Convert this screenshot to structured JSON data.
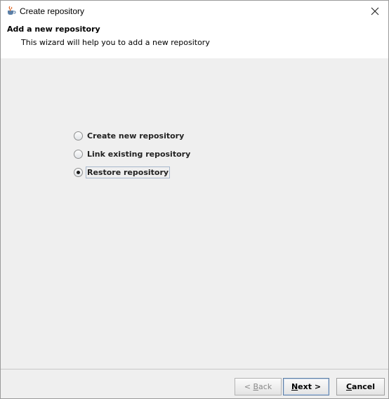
{
  "window": {
    "title": "Create repository",
    "app_icon": "coffee-cup-icon",
    "close_icon": "close-icon"
  },
  "header": {
    "title": "Add a new repository",
    "subtitle": "This wizard will help you to add a new repository"
  },
  "options": [
    {
      "label": "Create new repository",
      "checked": false
    },
    {
      "label": "Link existing repository",
      "checked": false
    },
    {
      "label": "Restore repository",
      "checked": true
    }
  ],
  "footer": {
    "back": {
      "prefix": "< ",
      "mnemonic": "B",
      "rest": "ack",
      "enabled": false
    },
    "next": {
      "mnemonic": "N",
      "rest": "ext >",
      "enabled": true
    },
    "cancel": {
      "mnemonic": "C",
      "rest": "ancel",
      "enabled": true
    }
  }
}
